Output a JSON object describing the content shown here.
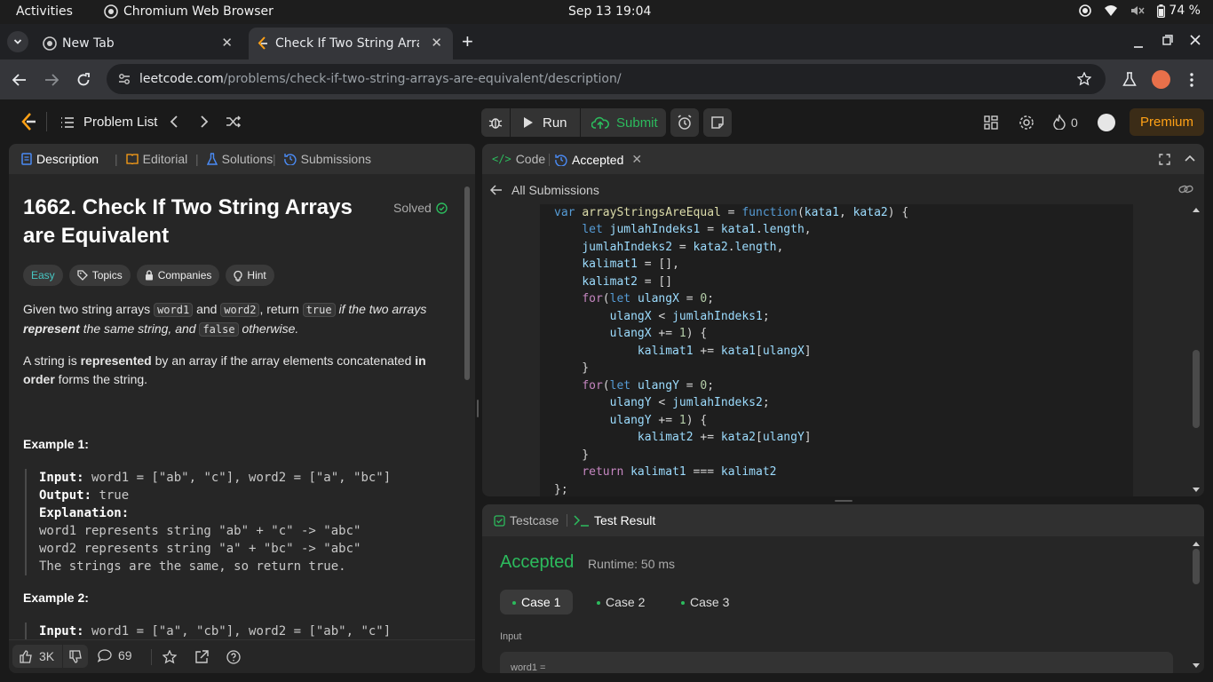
{
  "os": {
    "activities": "Activities",
    "app_name": "Chromium Web Browser",
    "clock": "Sep 13  19:04",
    "battery": "74 %"
  },
  "browser": {
    "tabs": [
      {
        "title": "New Tab",
        "active": false
      },
      {
        "title": "Check If Two String Array",
        "active": true
      }
    ],
    "url_host": "leetcode.com",
    "url_path": "/problems/check-if-two-string-arrays-are-equivalent/description/"
  },
  "nav": {
    "problem_list": "Problem List",
    "run": "Run",
    "submit": "Submit",
    "streak": "0",
    "premium": "Premium"
  },
  "left_panel": {
    "tabs": [
      "Description",
      "Editorial",
      "Solutions",
      "Submissions"
    ],
    "title_line1": "1662. Check If Two String Arrays",
    "title_line2": "are Equivalent",
    "status": "Solved",
    "difficulty": "Easy",
    "pills": [
      "Topics",
      "Companies",
      "Hint"
    ],
    "desc": {
      "p1_a": "Given two string arrays ",
      "p1_code1": "word1",
      "p1_b": " and ",
      "p1_code2": "word2",
      "p1_c": ", return ",
      "p1_code3": "true",
      "p1_d": " if the two arrays",
      "p1_e": "represent",
      "p1_f": " the same string, and ",
      "p1_code4": "false",
      "p1_g": " otherwise.",
      "p2_a": "A string is ",
      "p2_b": "represented",
      "p2_c": " by an array if the array elements concatenated ",
      "p2_d": "in",
      "p2_e": "order",
      "p2_f": " forms the string."
    },
    "example1": {
      "heading": "Example 1:",
      "input_label": "Input:",
      "input": " word1 = [\"ab\", \"c\"], word2 = [\"a\", \"bc\"]",
      "output_label": "Output:",
      "output": " true",
      "explanation_label": "Explanation:",
      "lines": [
        "word1 represents string \"ab\" + \"c\" -> \"abc\"",
        "word2 represents string \"a\" + \"bc\" -> \"abc\"",
        "The strings are the same, so return true."
      ]
    },
    "example2": {
      "heading": "Example 2:",
      "input_label": "Input:",
      "input": " word1 = [\"a\", \"cb\"], word2 = [\"ab\", \"c\"]"
    },
    "footer": {
      "likes": "3K",
      "comments": "69"
    }
  },
  "code_panel": {
    "tab_code": "Code",
    "tab_accepted": "Accepted",
    "back": "All Submissions"
  },
  "code_lines": [
    "var arrayStringsAreEqual = function(kata1, kata2) {",
    "    let jumlahIndeks1 = kata1.length,",
    "    jumlahIndeks2 = kata2.length,",
    "    kalimat1 = [],",
    "    kalimat2 = []",
    "    for(let ulangX = 0;",
    "        ulangX < jumlahIndeks1;",
    "        ulangX += 1) {",
    "            kalimat1 += kata1[ulangX]",
    "    }",
    "    for(let ulangY = 0;",
    "        ulangY < jumlahIndeks2;",
    "        ulangY += 1) {",
    "            kalimat2 += kata2[ulangY]",
    "    }",
    "    return kalimat1 === kalimat2",
    "};"
  ],
  "result_panel": {
    "tab_testcase": "Testcase",
    "tab_result": "Test Result",
    "status": "Accepted",
    "runtime": "Runtime: 50 ms",
    "cases": [
      "Case 1",
      "Case 2",
      "Case 3"
    ],
    "input_label": "Input",
    "field": "word1 ="
  },
  "colors": {
    "accent_green": "#2cbb5d",
    "easy": "#46c6c2",
    "premium": "#ffa116",
    "bg": "#1a1a1a",
    "panel": "#262626"
  }
}
